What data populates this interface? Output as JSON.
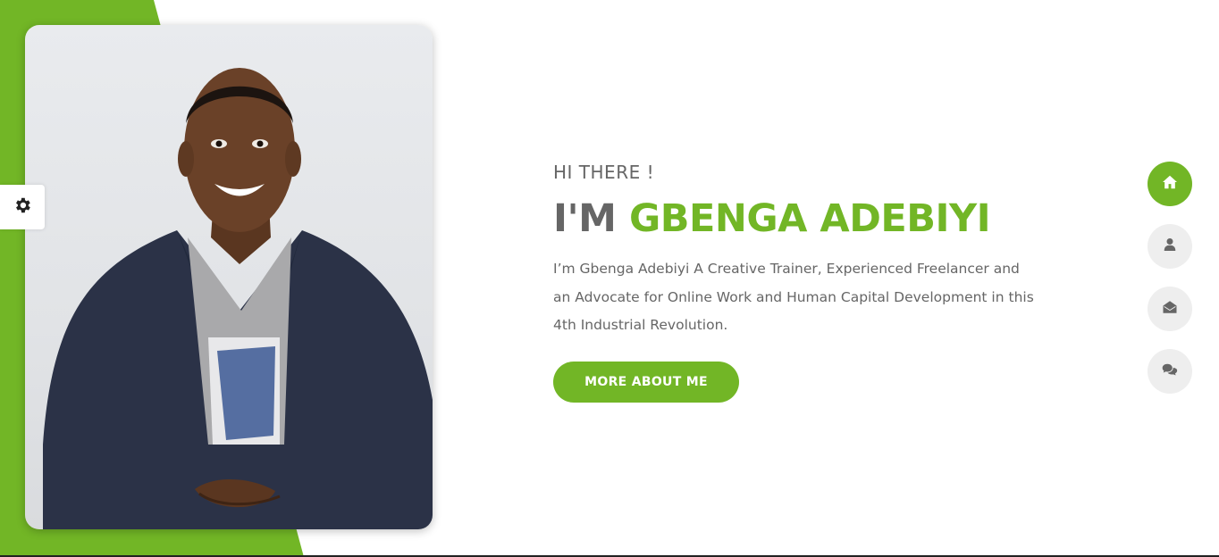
{
  "hero": {
    "greeting": "HI THERE !",
    "name_prefix": "I'M",
    "name_highlight": "GBENGA ADEBIYI",
    "bio": "I’m Gbenga Adebiyi A Creative Trainer, Experienced Freelancer and an Advocate for Online Work and Human Capital Development in this 4th Industrial Revolution.",
    "cta_label": "MORE ABOUT ME"
  },
  "settings": {
    "icon": "gear-icon"
  },
  "nav": [
    {
      "icon": "home-icon",
      "active": true
    },
    {
      "icon": "user-icon",
      "active": false
    },
    {
      "icon": "envelope-open-icon",
      "active": false
    },
    {
      "icon": "comments-icon",
      "active": false
    }
  ],
  "colors": {
    "accent": "#72b626",
    "text": "#666666",
    "nav_inactive_bg": "#eeeeee",
    "nav_inactive_icon": "#666666"
  }
}
